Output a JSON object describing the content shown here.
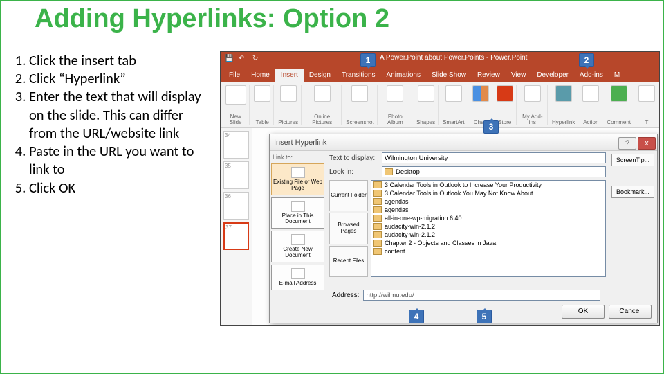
{
  "title": "Adding Hyperlinks: Option 2",
  "steps": [
    "Click the insert tab",
    "Click “Hyperlink”",
    "Enter the text that will display on the slide. This can differ from the URL/website link",
    "Paste in the URL you want to link to",
    "Click OK"
  ],
  "callouts": [
    "1",
    "2",
    "3",
    "4",
    "5"
  ],
  "powerpoint": {
    "window_title": "A Power.Point about Power.Points - Power.Point",
    "tabs": [
      "File",
      "Home",
      "Insert",
      "Design",
      "Transitions",
      "Animations",
      "Slide Show",
      "Review",
      "View",
      "Developer",
      "Add-ins",
      "M"
    ],
    "active_tab": "Insert",
    "ribbon": [
      {
        "label": "New\nSlide"
      },
      {
        "label": "Table"
      },
      {
        "label": "Pictures"
      },
      {
        "label": "Online\nPictures"
      },
      {
        "label": "Screenshot"
      },
      {
        "label": "Photo\nAlbum"
      },
      {
        "label": "Shapes"
      },
      {
        "label": "SmartArt"
      },
      {
        "label": "Chart"
      },
      {
        "label": "Store"
      },
      {
        "label": "My Add-ins"
      },
      {
        "label": "Hyperlink"
      },
      {
        "label": "Action"
      },
      {
        "label": "Comment"
      },
      {
        "label": "T"
      }
    ],
    "thumbs": [
      "34",
      "35",
      "36",
      "37"
    ]
  },
  "dialog": {
    "title": "Insert Hyperlink",
    "linkto_label": "Link to:",
    "linkto_options": [
      "Existing File or Web Page",
      "Place in This Document",
      "Create New Document",
      "E-mail Address"
    ],
    "text_to_display_label": "Text to display:",
    "text_to_display_value": "Wilmington University",
    "lookin_label": "Look in:",
    "lookin_value": "Desktop",
    "panes": [
      "Current Folder",
      "Browsed Pages",
      "Recent Files"
    ],
    "files": [
      "3 Calendar Tools in Outlook to Increase Your Productivity",
      "3 Calendar Tools in Outlook You May Not Know About",
      "agendas",
      "agendas",
      "all-in-one-wp-migration.6.40",
      "audacity-win-2.1.2",
      "audacity-win-2.1.2",
      "Chapter 2 - Objects and Classes in Java",
      "content"
    ],
    "address_label": "Address:",
    "address_value": "http://wilmu.edu/",
    "screentip": "ScreenTip...",
    "bookmark": "Bookmark...",
    "ok": "OK",
    "cancel": "Cancel",
    "help": "?",
    "close": "x"
  }
}
